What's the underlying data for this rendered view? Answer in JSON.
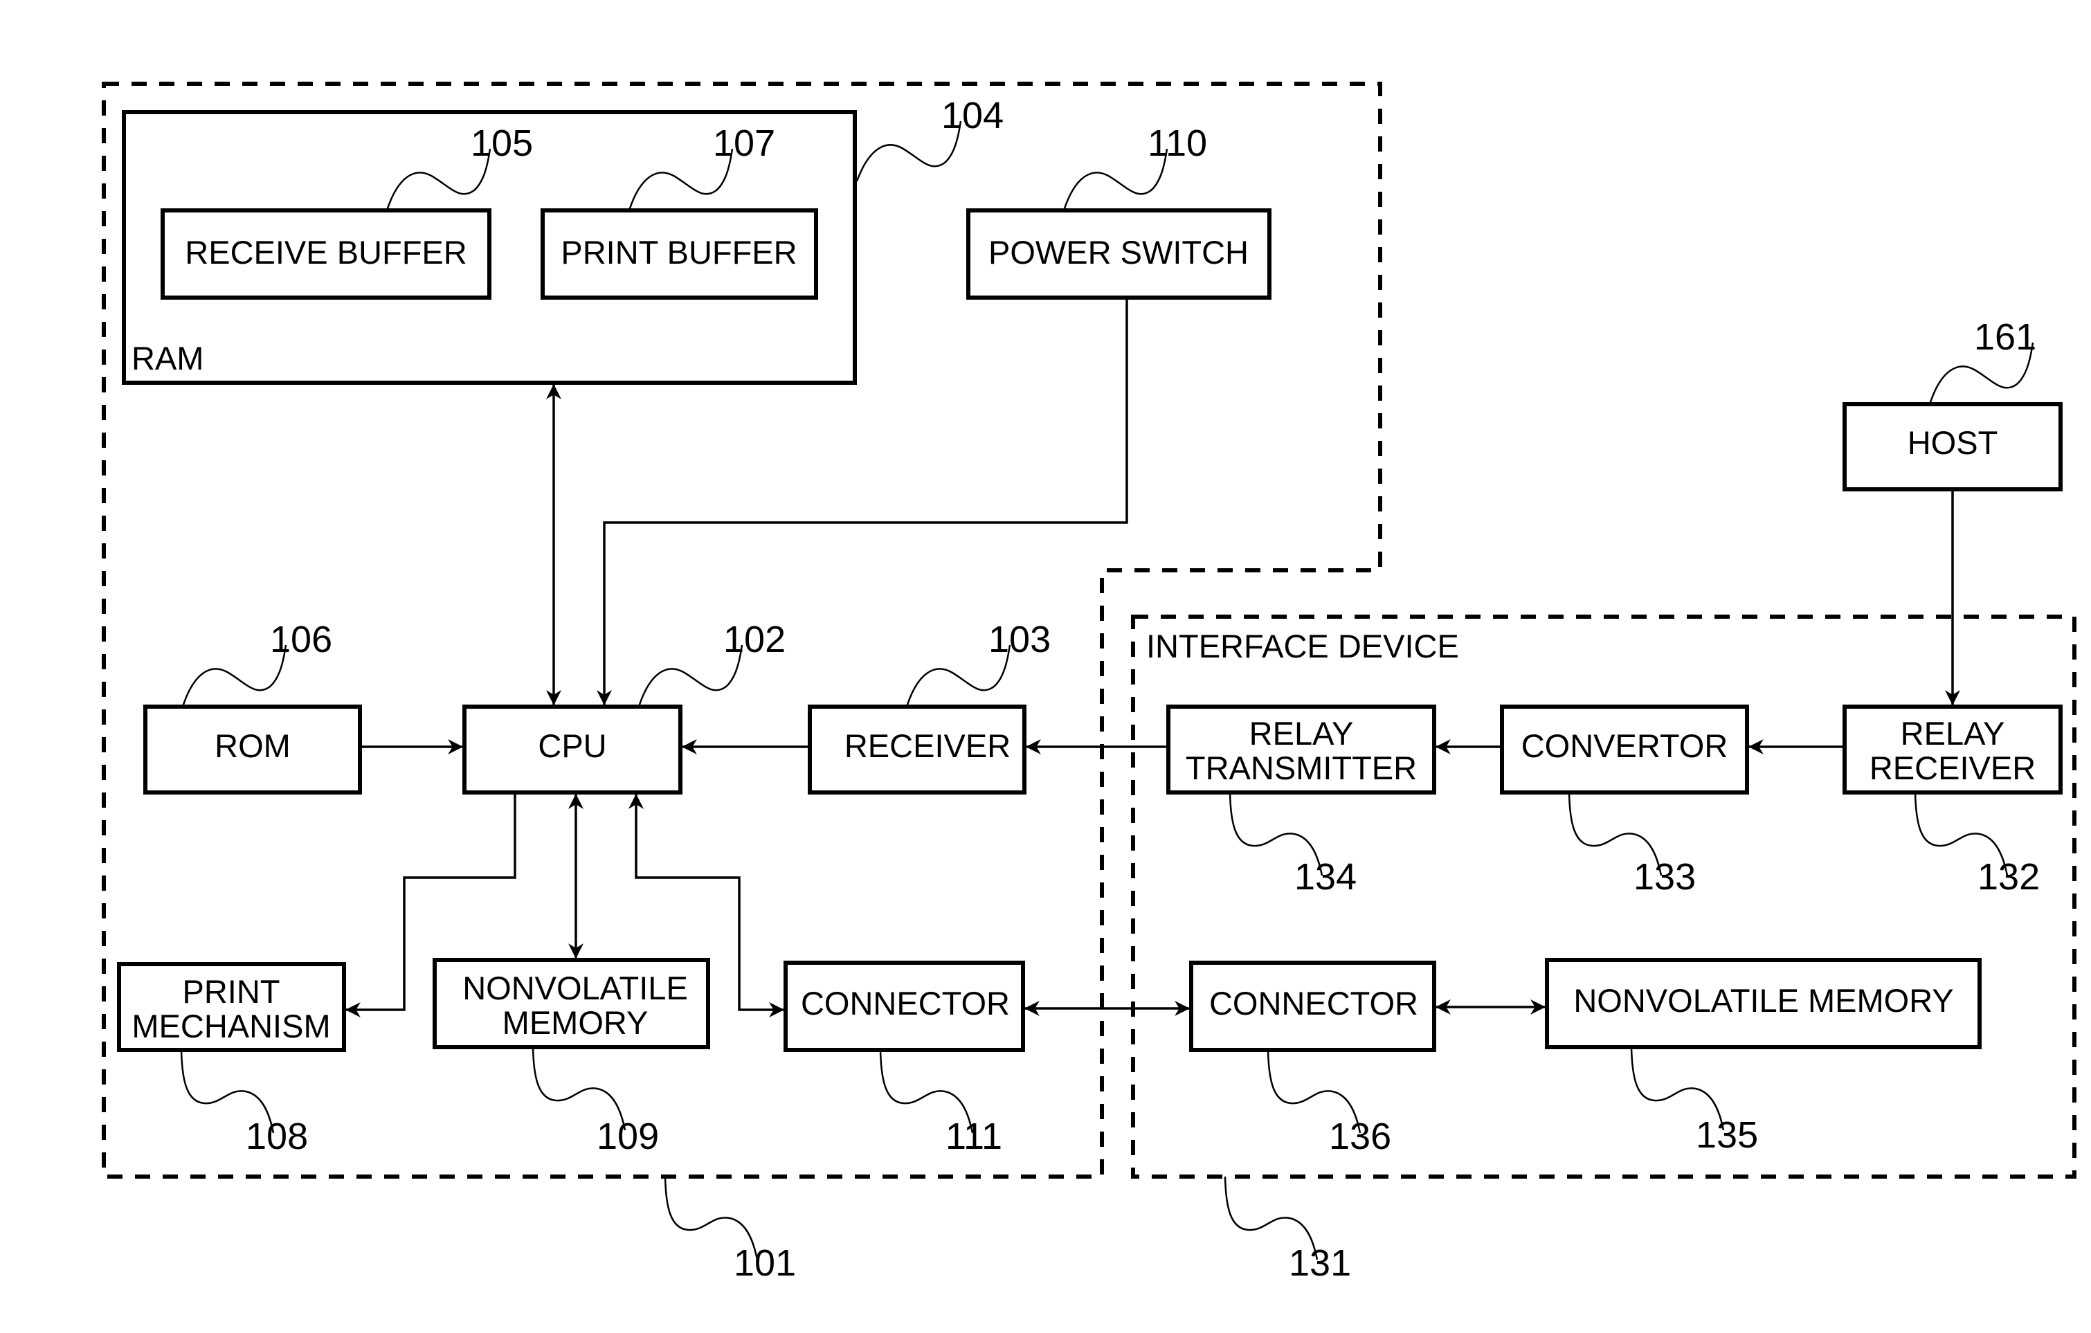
{
  "diagram": {
    "type": "block-diagram",
    "colors": {
      "stroke": "#000000",
      "background": "#ffffff"
    },
    "regions": {
      "printer": {
        "ref": "101",
        "label": ""
      },
      "interface_device": {
        "ref": "131",
        "label": "INTERFACE DEVICE"
      }
    },
    "blocks": {
      "ram": {
        "ref": "104",
        "label": "RAM"
      },
      "receive_buffer": {
        "ref": "105",
        "label": "RECEIVE BUFFER"
      },
      "print_buffer": {
        "ref": "107",
        "label": "PRINT BUFFER"
      },
      "power_switch": {
        "ref": "110",
        "label": "POWER SWITCH"
      },
      "rom": {
        "ref": "106",
        "label": "ROM"
      },
      "cpu": {
        "ref": "102",
        "label": "CPU"
      },
      "receiver": {
        "ref": "103",
        "label": "RECEIVER"
      },
      "relay_transmitter": {
        "ref": "134",
        "label_lines": [
          "RELAY",
          "TRANSMITTER"
        ]
      },
      "convertor": {
        "ref": "133",
        "label": "CONVERTOR"
      },
      "relay_receiver": {
        "ref": "132",
        "label_lines": [
          "RELAY",
          "RECEIVER"
        ]
      },
      "host": {
        "ref": "161",
        "label": "HOST"
      },
      "print_mechanism": {
        "ref": "108",
        "label_lines": [
          "PRINT",
          "MECHANISM"
        ]
      },
      "nonvolatile_memory_printer": {
        "ref": "109",
        "label_lines": [
          "NONVOLATILE",
          "MEMORY"
        ]
      },
      "connector_printer": {
        "ref": "111",
        "label": "CONNECTOR"
      },
      "connector_interface": {
        "ref": "136",
        "label": "CONNECTOR"
      },
      "nonvolatile_memory_interface": {
        "ref": "135",
        "label": "NONVOLATILE MEMORY"
      }
    },
    "connections": [
      {
        "from": "RAM",
        "to": "CPU",
        "direction": "bidirectional"
      },
      {
        "from": "POWER SWITCH",
        "to": "CPU",
        "direction": "forward"
      },
      {
        "from": "ROM",
        "to": "CPU",
        "direction": "forward"
      },
      {
        "from": "RECEIVER",
        "to": "CPU",
        "direction": "forward"
      },
      {
        "from": "RELAY TRANSMITTER",
        "to": "RECEIVER",
        "direction": "forward"
      },
      {
        "from": "CONVERTOR",
        "to": "RELAY TRANSMITTER",
        "direction": "forward"
      },
      {
        "from": "RELAY RECEIVER",
        "to": "CONVERTOR",
        "direction": "forward"
      },
      {
        "from": "HOST",
        "to": "RELAY RECEIVER",
        "direction": "forward"
      },
      {
        "from": "CPU",
        "to": "PRINT MECHANISM",
        "direction": "forward"
      },
      {
        "from": "CPU",
        "to": "NONVOLATILE MEMORY (109)",
        "direction": "bidirectional"
      },
      {
        "from": "CPU",
        "to": "CONNECTOR (111)",
        "direction": "bidirectional"
      },
      {
        "from": "CONNECTOR (111)",
        "to": "CONNECTOR (136)",
        "direction": "bidirectional"
      },
      {
        "from": "CONNECTOR (136)",
        "to": "NONVOLATILE MEMORY (135)",
        "direction": "bidirectional"
      }
    ]
  }
}
